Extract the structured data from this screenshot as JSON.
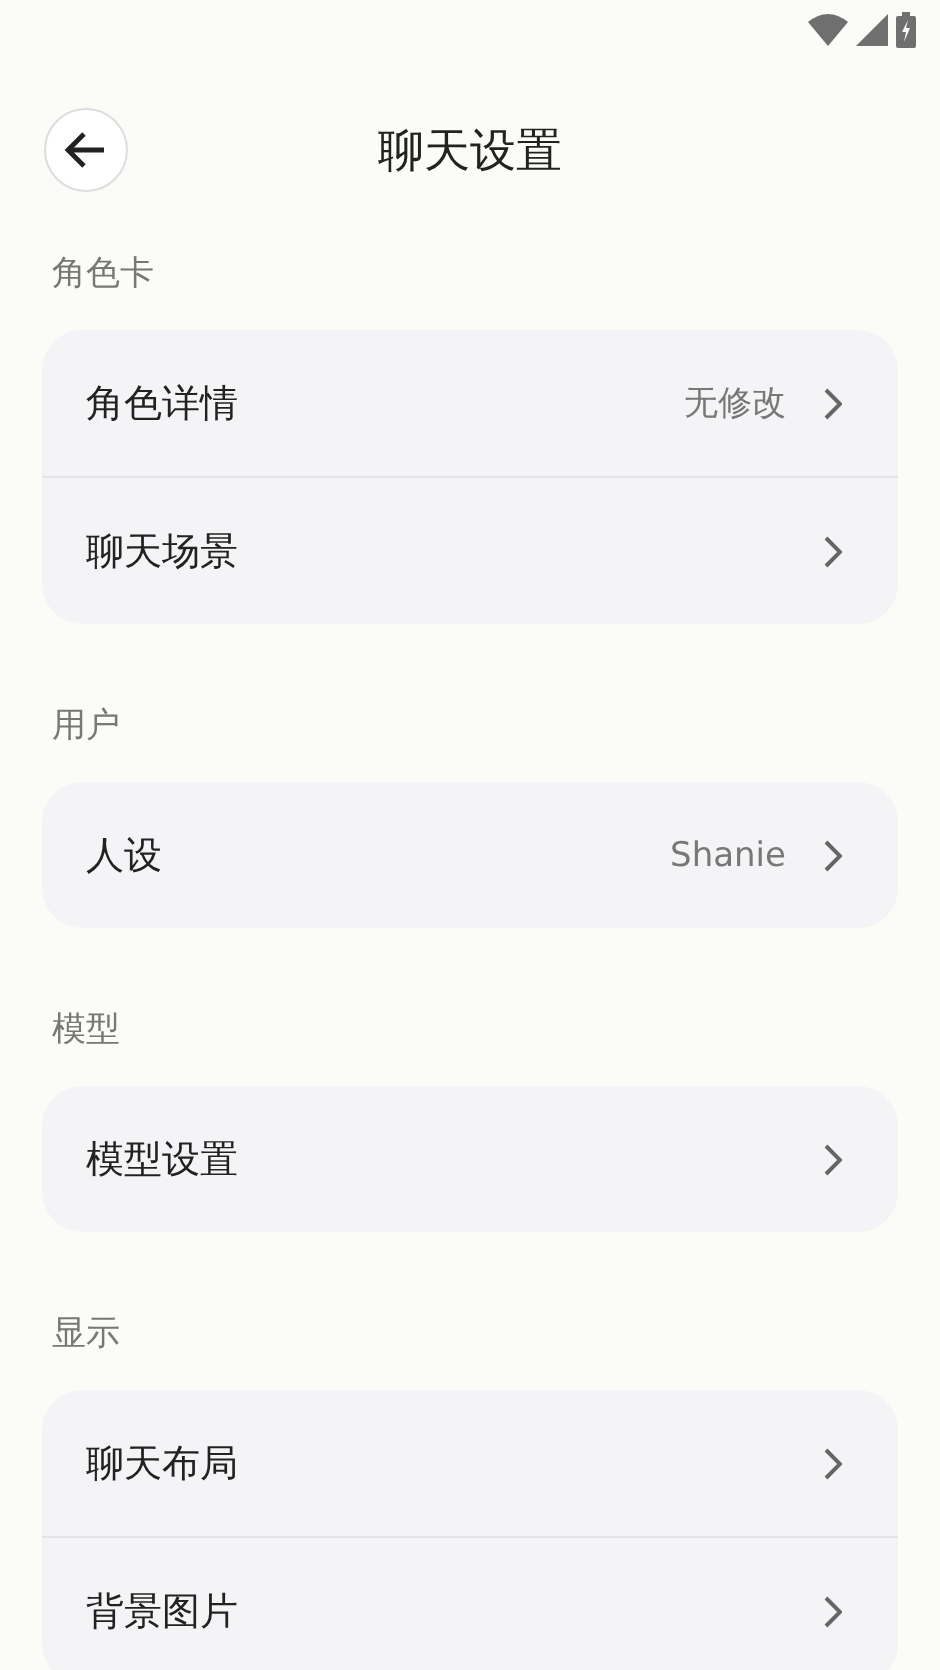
{
  "header": {
    "title": "聊天设置"
  },
  "sections": [
    {
      "title": "角色卡",
      "items": [
        {
          "label": "角色详情",
          "value": "无修改"
        },
        {
          "label": "聊天场景"
        }
      ]
    },
    {
      "title": "用户",
      "items": [
        {
          "label": "人设",
          "value": "Shanie"
        }
      ]
    },
    {
      "title": "模型",
      "items": [
        {
          "label": "模型设置"
        }
      ]
    },
    {
      "title": "显示",
      "items": [
        {
          "label": "聊天布局"
        },
        {
          "label": "背景图片"
        }
      ]
    }
  ]
}
